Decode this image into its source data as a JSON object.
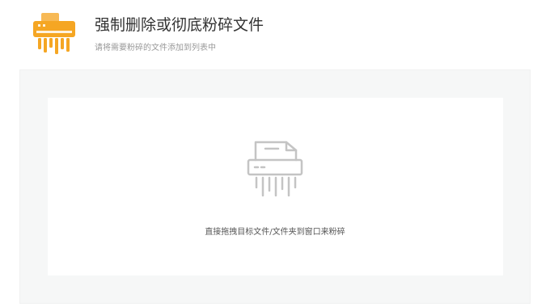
{
  "header": {
    "title": "强制删除或彻底粉碎文件",
    "subtitle": "请将需要粉碎的文件添加到列表中",
    "logo_icon": "shredder-logo-icon"
  },
  "drop_area": {
    "icon": "shredder-icon",
    "hint": "直接拖拽目标文件/文件夹到窗口来粉碎"
  },
  "colors": {
    "accent": "#f5a623",
    "panel_background": "#f6f7f7",
    "drop_zone_background": "#ffffff",
    "icon_gray": "#c4c4c4"
  }
}
